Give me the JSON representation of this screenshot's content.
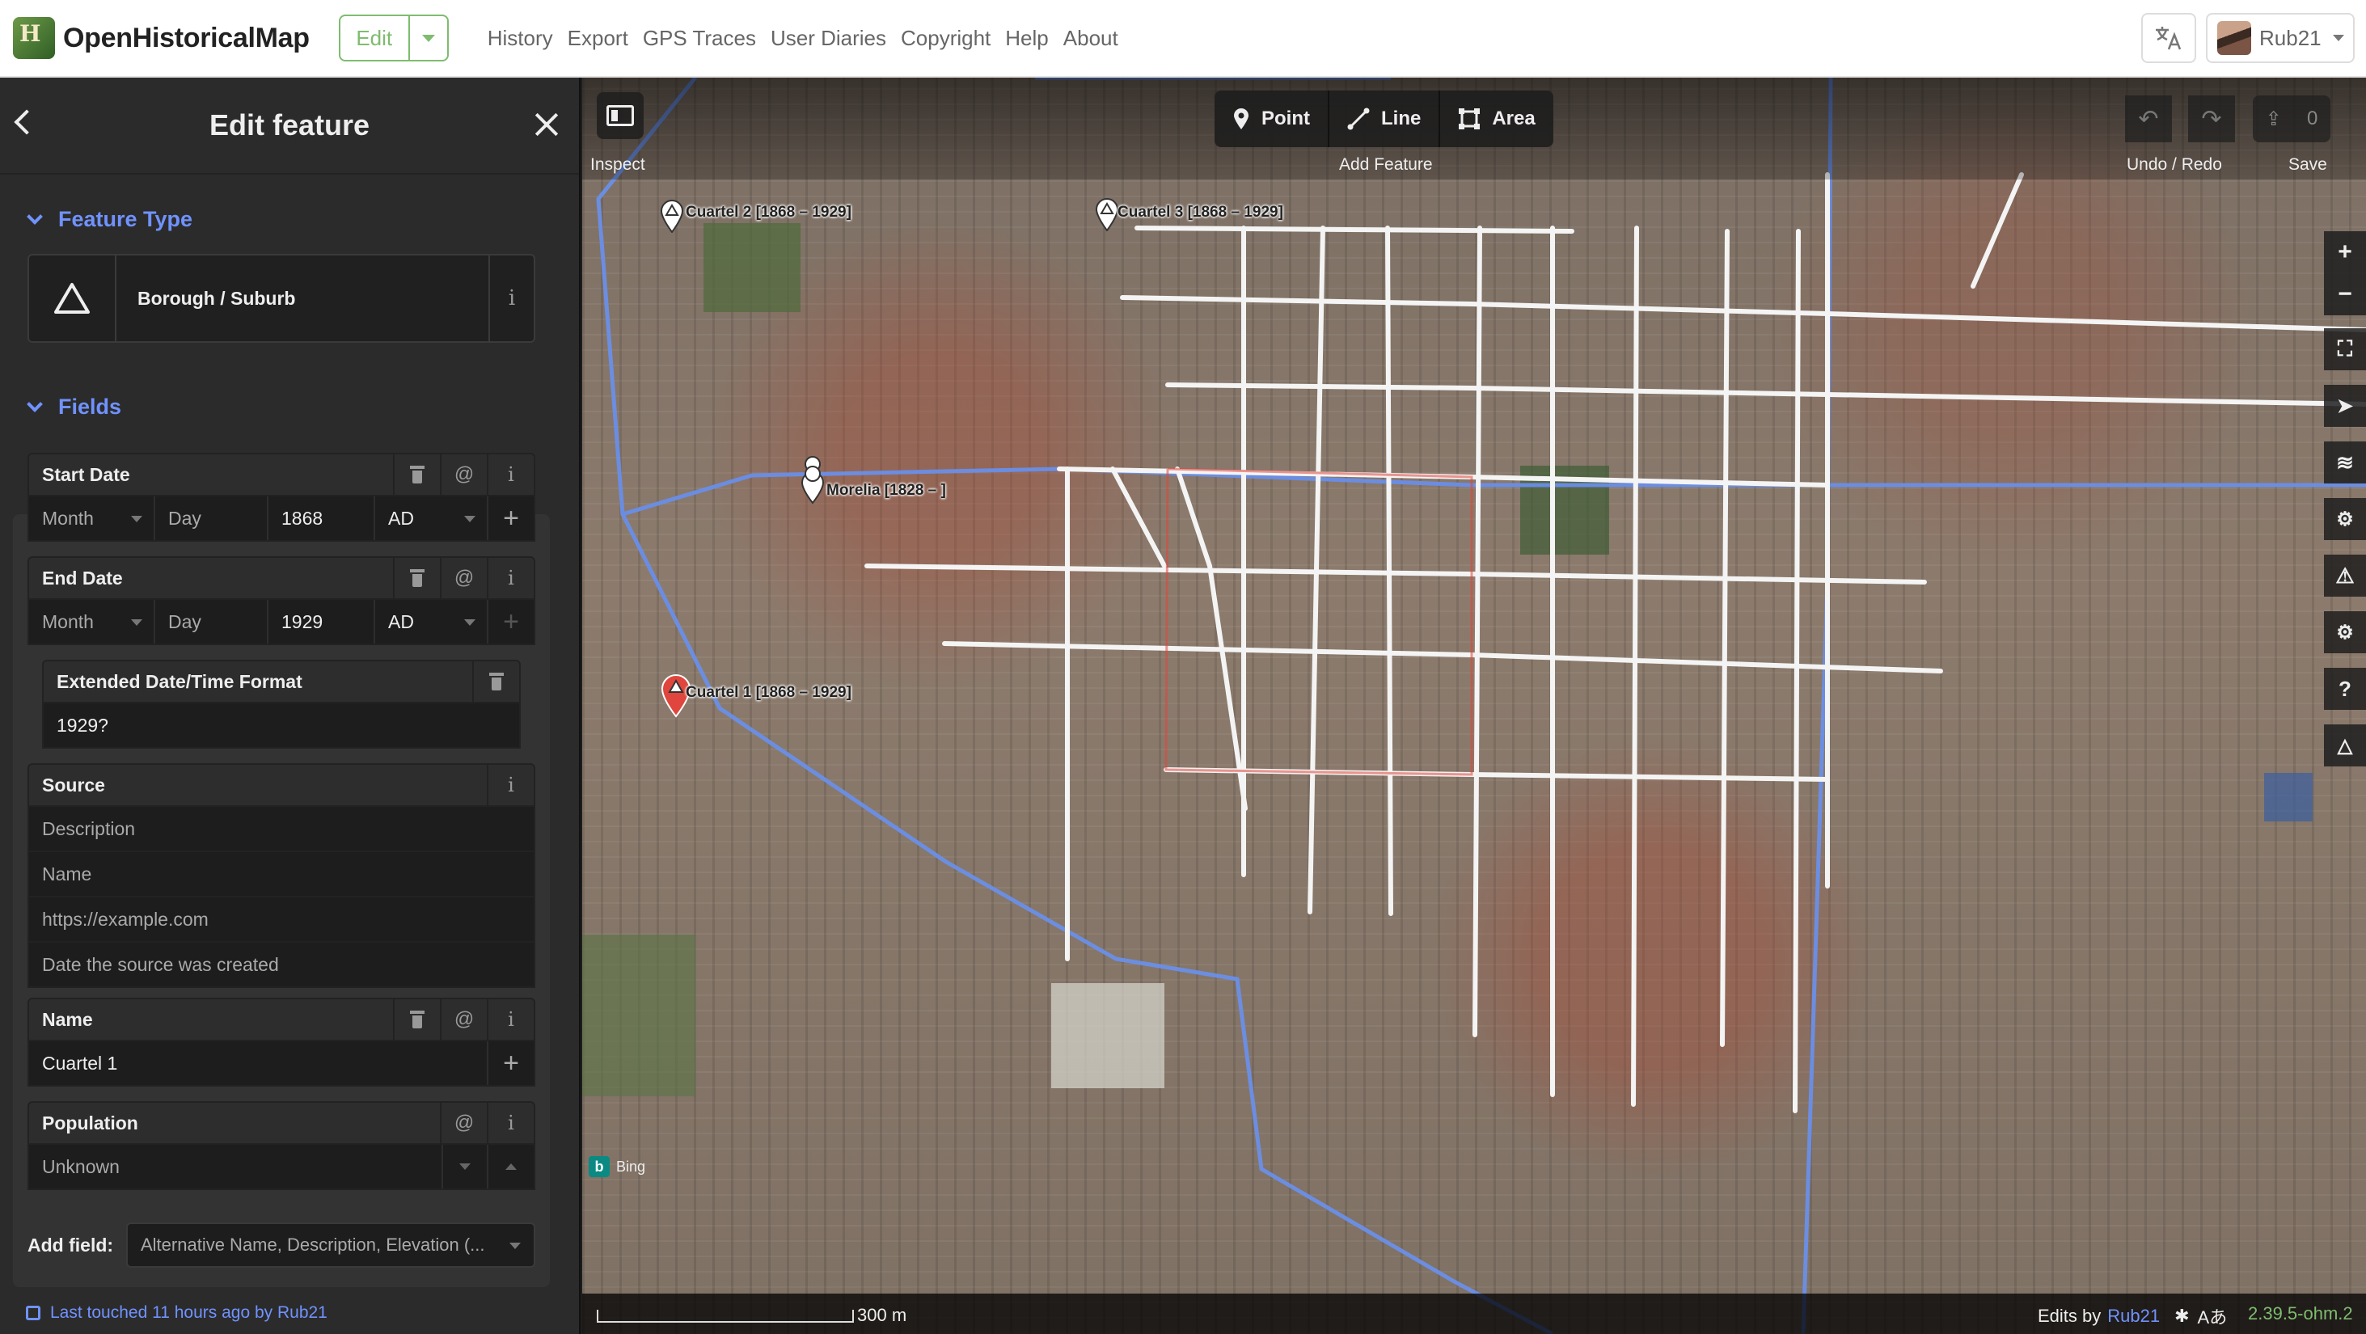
{
  "nav": {
    "logo_text": "OpenHistoricalMap",
    "edit_label": "Edit",
    "links": [
      "History",
      "Export",
      "GPS Traces",
      "User Diaries",
      "Copyright",
      "Help",
      "About"
    ],
    "user_name": "Rub21"
  },
  "sidebar": {
    "title": "Edit feature",
    "feature_type_title": "Feature Type",
    "preset_label": "Borough / Suburb",
    "fields_title": "Fields",
    "start_date": {
      "label": "Start Date",
      "month_placeholder": "Month",
      "day_placeholder": "Day",
      "year": "1868",
      "era": "AD"
    },
    "end_date": {
      "label": "End Date",
      "month_placeholder": "Month",
      "day_placeholder": "Day",
      "year": "1929",
      "era": "AD"
    },
    "edtf": {
      "label": "Extended Date/Time Format",
      "value": "1929?"
    },
    "source": {
      "label": "Source",
      "description_placeholder": "Description",
      "name_placeholder": "Name",
      "url_placeholder": "https://example.com",
      "date_placeholder": "Date the source was created"
    },
    "name_field": {
      "label": "Name",
      "value": "Cuartel 1"
    },
    "population": {
      "label": "Population",
      "value": "Unknown"
    },
    "add_field_label": "Add field:",
    "add_field_placeholder": "Alternative Name, Description, Elevation (...",
    "last_touched": "Last touched 11 hours ago by Rub21"
  },
  "map": {
    "inspect_label": "Inspect",
    "add_feature_label": "Add Feature",
    "modes": [
      "Point",
      "Line",
      "Area"
    ],
    "undo_redo_label": "Undo / Redo",
    "save_label": "Save",
    "save_count": "0",
    "labels": {
      "cuartel1": "Cuartel 1 [1868 – 1929]",
      "cuartel2": "Cuartel 2 [1868 – 1929]",
      "cuartel3": "Cuartel 3 [1868 – 1929]",
      "morelia": "Morelia [1828 – ]"
    },
    "imagery": "Bing",
    "scale": "300 m",
    "edits_by": "Edits by",
    "edits_user": "Rub21",
    "version": "2.39.5-ohm.2",
    "colors": {
      "accent": "#7092ff",
      "brand": "#7ebc6f",
      "selected": "#e0463d",
      "boundary": "#6a8fe8"
    }
  }
}
